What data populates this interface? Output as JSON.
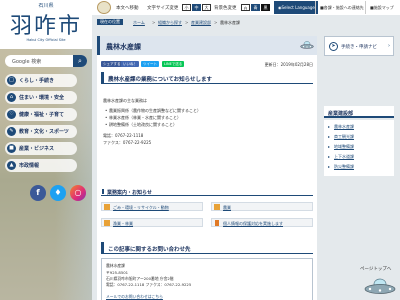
{
  "sidebar": {
    "logo_sub": "石川県",
    "logo_main": "羽咋市",
    "logo_en": "Hakui City Official Site",
    "search_label": "Google 検索",
    "nav": [
      {
        "label": "くらし・手続き"
      },
      {
        "label": "住まい・環境・安全"
      },
      {
        "label": "健康・福祉・子育て"
      },
      {
        "label": "教育・文化・スポーツ"
      },
      {
        "label": "産業・ビジネス"
      },
      {
        "label": "市政情報"
      }
    ]
  },
  "topbar": {
    "brand": "本文へ移動",
    "font_size_label": "文字サイズ変更",
    "font_sizes": [
      "小",
      "中",
      "大"
    ],
    "bg_color_label": "背景色変更",
    "bg_colors": [
      "白",
      "青",
      "黒"
    ],
    "language": "Select Language",
    "facility": "各課・施設への連絡先",
    "sitemap": "施設マップ"
  },
  "breadcrumb": {
    "label": "現在の位置",
    "items": [
      "ホーム",
      "組織から探す",
      "産業建設部",
      "農林水産課"
    ]
  },
  "main": {
    "title": "農林水産課",
    "share": [
      "シェアする",
      "いいね！",
      "ツイート",
      "LINEで送る"
    ],
    "updated": "更新日：2019年02月28日",
    "notice_title": "農林水産課の業務についてお知らせします",
    "intro": "農林水産課の主な業務は",
    "duties": [
      "農業振興係（農作物の生産調整などに関すること）",
      "林業水産係（林業・水産に関すること）",
      "耕地整備係（土地改良に関すること）"
    ],
    "tel": "電話：0767-22-1118",
    "fax": "ファクス：0767-22-9225",
    "news_title": "業務案内・お知らせ",
    "links": [
      "ごみ・環境・リサイクル・動物",
      "農業",
      "漁業・林業",
      "個人情報の保護対応を実施します"
    ],
    "contact_title": "この記事に関するお問い合わせ先",
    "contact": {
      "dept": "農林水産課",
      "zip": "〒925-8501",
      "address": "石川県羽咋市旭町アー200番地 庁舎2階",
      "tel": "電話：0767-22-1118 ファクス：0767-22-9225",
      "form": "メールでのお問い合わせはこちら"
    }
  },
  "right": {
    "navi": "手続き・申請ナビ",
    "dept_title": "産業建設部",
    "dept_items": [
      "農林水産課",
      "商工観光課",
      "地域整備課",
      "上下水道課",
      "防災整備課"
    ]
  },
  "pagetop": "ページトップへ"
}
